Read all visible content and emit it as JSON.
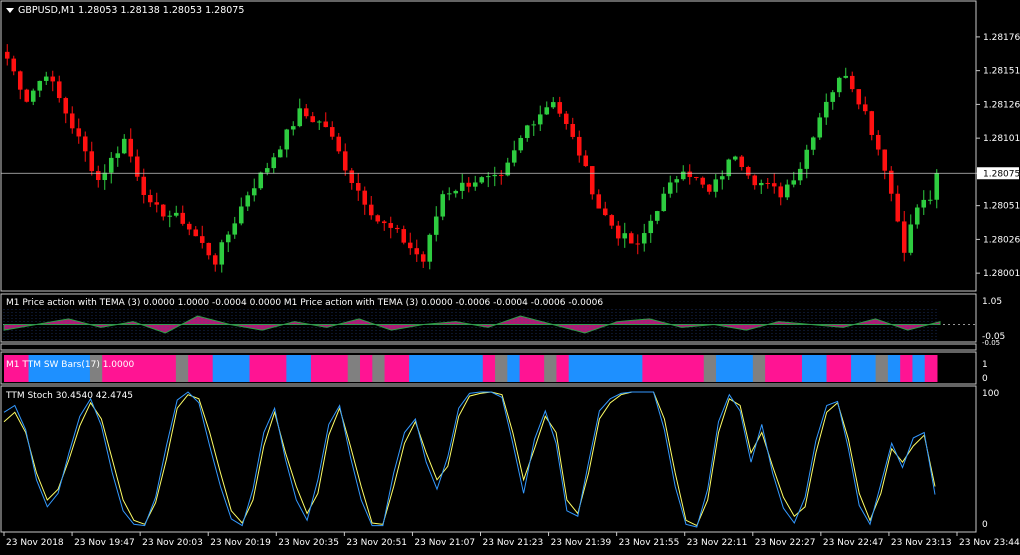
{
  "colors": {
    "background": "#000000",
    "frame": "#c8c8c8",
    "text": "#ffffff",
    "bull": "#2ecc40",
    "bear": "#ff1111",
    "magenta": "#ff1493",
    "blue": "#1e90ff",
    "gray": "#808080",
    "tema": "#cc2288",
    "tema_green": "#2ea043",
    "stoch_main": "#ffff66",
    "stoch_signal": "#3399ff"
  },
  "main_panel": {
    "header": "GBPUSD,M1  1.28053 1.28138 1.28053 1.28075",
    "menu_icon": "triangle-down-icon",
    "current_price_label": "1.28075",
    "current_price": 1.28075
  },
  "price_axis": {
    "ticks": [
      "1.28176",
      "1.28151",
      "1.28126",
      "1.28101",
      "1.28075",
      "1.28051",
      "1.28026",
      "1.28001"
    ],
    "tick_values": [
      1.28176,
      1.28151,
      1.28126,
      1.28101,
      1.28075,
      1.28051,
      1.28026,
      1.28001
    ]
  },
  "tema_panel": {
    "label": "M1 Price action with TEMA (3) 0.0000 1.0000 -0.0004 0.0000  M1 Price action with TEMA (3) 0.0000 -0.0006 -0.0004 -0.0006 -0.0006",
    "axis_labels": [
      "1.05",
      "-0.05",
      "-0.05"
    ],
    "axis_values": [
      1.05,
      -0.05
    ]
  },
  "bars_panel": {
    "label": "M1  TTM SW Bars(17) 1.0000",
    "axis_labels": [
      "1",
      "0"
    ],
    "segments": [
      {
        "color": "magenta",
        "w": 2
      },
      {
        "color": "blue",
        "w": 5
      },
      {
        "color": "gray",
        "w": 1
      },
      {
        "color": "magenta",
        "w": 6
      },
      {
        "color": "gray",
        "w": 1
      },
      {
        "color": "magenta",
        "w": 2
      },
      {
        "color": "blue",
        "w": 3
      },
      {
        "color": "magenta",
        "w": 3
      },
      {
        "color": "blue",
        "w": 2
      },
      {
        "color": "magenta",
        "w": 3
      },
      {
        "color": "gray",
        "w": 1
      },
      {
        "color": "magenta",
        "w": 1
      },
      {
        "color": "gray",
        "w": 1
      },
      {
        "color": "magenta",
        "w": 2
      },
      {
        "color": "blue",
        "w": 6
      },
      {
        "color": "magenta",
        "w": 1
      },
      {
        "color": "gray",
        "w": 1
      },
      {
        "color": "blue",
        "w": 1
      },
      {
        "color": "magenta",
        "w": 2
      },
      {
        "color": "gray",
        "w": 1
      },
      {
        "color": "magenta",
        "w": 1
      },
      {
        "color": "blue",
        "w": 6
      },
      {
        "color": "magenta",
        "w": 5
      },
      {
        "color": "gray",
        "w": 1
      },
      {
        "color": "blue",
        "w": 3
      },
      {
        "color": "gray",
        "w": 1
      },
      {
        "color": "magenta",
        "w": 3
      },
      {
        "color": "blue",
        "w": 2
      },
      {
        "color": "magenta",
        "w": 2
      },
      {
        "color": "blue",
        "w": 2
      },
      {
        "color": "gray",
        "w": 1
      },
      {
        "color": "blue",
        "w": 1
      },
      {
        "color": "magenta",
        "w": 1
      },
      {
        "color": "blue",
        "w": 1
      },
      {
        "color": "magenta",
        "w": 1
      }
    ]
  },
  "stoch_panel": {
    "label": "TTM Stoch 30.4540 42.4745",
    "axis_labels": [
      "100",
      "0"
    ],
    "axis_values": [
      100,
      0
    ]
  },
  "time_axis": {
    "labels": [
      "23 Nov 2018",
      "23 Nov 19:47",
      "23 Nov 20:03",
      "23 Nov 20:19",
      "23 Nov 20:35",
      "23 Nov 20:51",
      "23 Nov 21:07",
      "23 Nov 21:23",
      "23 Nov 21:39",
      "23 Nov 21:55",
      "23 Nov 22:11",
      "23 Nov 22:27",
      "23 Nov 22:47",
      "23 Nov 23:13",
      "23 Nov 23:44"
    ]
  },
  "chart_data": [
    {
      "type": "candlestick",
      "title": "GBPUSD,M1",
      "x_range": [
        "23 Nov 2018",
        "23 Nov 23:44"
      ],
      "ylim": [
        1.2799,
        1.2819
      ],
      "grid": false,
      "close_path": [
        [
          0,
          1.2816
        ],
        [
          3,
          1.2813
        ],
        [
          6,
          1.2815
        ],
        [
          10,
          1.2811
        ],
        [
          14,
          1.2807
        ],
        [
          18,
          1.281
        ],
        [
          22,
          1.2805
        ],
        [
          27,
          1.2804
        ],
        [
          32,
          1.2801
        ],
        [
          37,
          1.2806
        ],
        [
          40,
          1.2808
        ],
        [
          45,
          1.2812
        ],
        [
          49,
          1.2811
        ],
        [
          53,
          1.2807
        ],
        [
          57,
          1.2804
        ],
        [
          60,
          1.2803
        ],
        [
          64,
          1.2801
        ],
        [
          67,
          1.2806
        ],
        [
          72,
          1.2807
        ],
        [
          76,
          1.2807
        ],
        [
          80,
          1.2811
        ],
        [
          84,
          1.2813
        ],
        [
          88,
          1.2809
        ],
        [
          91,
          1.2805
        ],
        [
          94,
          1.2803
        ],
        [
          97,
          1.2802
        ],
        [
          100,
          1.2805
        ],
        [
          104,
          1.2808
        ],
        [
          108,
          1.2806
        ],
        [
          112,
          1.2809
        ],
        [
          115,
          1.2807
        ],
        [
          119,
          1.2806
        ],
        [
          122,
          1.2808
        ],
        [
          126,
          1.2813
        ],
        [
          129,
          1.2815
        ],
        [
          132,
          1.2812
        ],
        [
          135,
          1.2808
        ],
        [
          138,
          1.2802
        ],
        [
          140,
          1.2805
        ],
        [
          143,
          1.2806
        ]
      ],
      "last_close": 1.28075
    },
    {
      "type": "area",
      "title": "M1 Price action with TEMA (3)",
      "ylim": [
        -0.05,
        1.05
      ],
      "series": [
        {
          "name": "Price action with TEMA",
          "values": [
            0.3,
            0.5,
            0.7,
            0.4,
            0.6,
            0.2,
            0.8,
            0.5,
            0.3,
            0.6,
            0.4,
            0.7,
            0.3,
            0.5,
            0.6,
            0.4,
            0.8,
            0.5,
            0.2,
            0.6,
            0.7,
            0.4,
            0.5,
            0.3,
            0.6,
            0.5,
            0.4,
            0.7,
            0.3,
            0.6
          ]
        }
      ]
    },
    {
      "type": "line",
      "title": "TTM Stoch",
      "ylim": [
        0,
        100
      ],
      "series": [
        {
          "name": "TTM Stoch",
          "values": [
            78,
            85,
            70,
            40,
            20,
            28,
            50,
            75,
            92,
            80,
            50,
            20,
            5,
            2,
            18,
            50,
            88,
            98,
            95,
            70,
            40,
            12,
            3,
            20,
            60,
            85,
            55,
            30,
            10,
            25,
            68,
            88,
            60,
            30,
            3,
            2,
            30,
            62,
            78,
            55,
            35,
            45,
            82,
            97,
            99,
            100,
            98,
            70,
            35,
            58,
            82,
            70,
            20,
            10,
            40,
            80,
            92,
            98,
            100,
            100,
            100,
            80,
            40,
            5,
            1,
            20,
            70,
            95,
            90,
            55,
            70,
            45,
            22,
            8,
            15,
            55,
            85,
            92,
            65,
            25,
            5,
            25,
            58,
            48,
            60,
            68,
            30
          ]
        },
        {
          "name": "Signal",
          "values": [
            85,
            90,
            72,
            35,
            15,
            25,
            55,
            82,
            95,
            75,
            40,
            12,
            2,
            1,
            22,
            60,
            94,
            100,
            92,
            60,
            30,
            6,
            1,
            28,
            70,
            88,
            50,
            20,
            5,
            35,
            76,
            90,
            52,
            20,
            1,
            1,
            40,
            70,
            80,
            48,
            28,
            52,
            88,
            99,
            100,
            100,
            96,
            62,
            25,
            65,
            86,
            62,
            12,
            8,
            48,
            86,
            95,
            99,
            100,
            100,
            100,
            72,
            30,
            2,
            0,
            28,
            78,
            98,
            86,
            48,
            76,
            40,
            14,
            3,
            22,
            64,
            90,
            93,
            58,
            16,
            2,
            32,
            62,
            44,
            66,
            70,
            24
          ]
        }
      ]
    }
  ]
}
